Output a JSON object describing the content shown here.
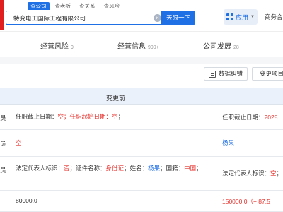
{
  "header": {
    "tabs": [
      "查公司",
      "查老板",
      "查关系",
      "查风险"
    ],
    "search_value": "特变电工国际工程有限公司",
    "search_button": "天眼一下",
    "app_label": "应用",
    "biz_label": "商务合"
  },
  "sections": [
    {
      "label": "经营风险",
      "count": "9"
    },
    {
      "label": "经营信息",
      "count": "999+"
    },
    {
      "label": "公司发展",
      "count": "28"
    }
  ],
  "toolbar": {
    "data_error": "数据纠错",
    "change_item": "变更项目"
  },
  "table": {
    "header_before": "变更前",
    "rows": [
      {
        "item": "员",
        "before": [
          {
            "t": "任职截止日期：",
            "c": ""
          },
          {
            "t": "空",
            "c": "red"
          },
          {
            "t": "；任职起始日期：",
            "c": "red"
          },
          {
            "t": "空",
            "c": "red"
          },
          {
            "t": "；",
            "c": ""
          }
        ],
        "after": [
          {
            "t": "任职截止日期：",
            "c": ""
          },
          {
            "t": "2028",
            "c": "red"
          }
        ]
      },
      {
        "item": "员",
        "before": [
          {
            "t": "空",
            "c": "red"
          }
        ],
        "after": [
          {
            "t": "杨果",
            "c": "blue"
          }
        ]
      },
      {
        "item": "员",
        "before": [
          {
            "t": "法定代表人标识：",
            "c": ""
          },
          {
            "t": "否",
            "c": "red"
          },
          {
            "t": "；证件名称：",
            "c": ""
          },
          {
            "t": "身份证",
            "c": "red"
          },
          {
            "t": "；姓名：",
            "c": ""
          },
          {
            "t": "杨果",
            "c": "blue"
          },
          {
            "t": "；国籍：",
            "c": ""
          },
          {
            "t": "中国",
            "c": "red"
          },
          {
            "t": "；",
            "c": ""
          }
        ],
        "after": [
          {
            "t": "法定代表人标识：",
            "c": ""
          },
          {
            "t": "空",
            "c": "red"
          },
          {
            "t": "；",
            "c": ""
          }
        ]
      },
      {
        "item": "",
        "before": [
          {
            "t": "80000.0",
            "c": ""
          }
        ],
        "after": [
          {
            "t": "150000.0",
            "c": "red"
          },
          {
            "t": "（+ 87.5",
            "c": "red"
          }
        ]
      }
    ]
  }
}
